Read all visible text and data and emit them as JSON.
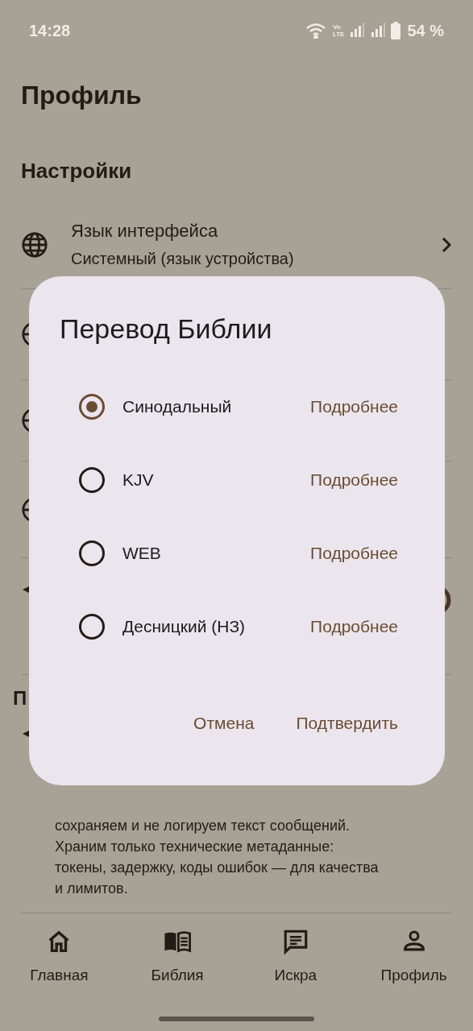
{
  "status_bar": {
    "time": "14:28",
    "network_badge": [
      "Vo",
      "LTE"
    ],
    "battery": "54 %"
  },
  "page": {
    "title": "Профиль",
    "section": "Настройки",
    "rows": [
      {
        "kind": "language",
        "title": "Язык интерфейса",
        "subtitle": "Системный (язык устройства)"
      },
      {
        "kind": "setting"
      },
      {
        "kind": "setting"
      },
      {
        "kind": "setting"
      },
      {
        "kind": "toggle"
      }
    ],
    "section2": "П",
    "info_text": "сохраняем и не логируем текст сообщений.\nХраним только технические метаданные:\nтокены, задержку, коды ошибок — для качества\nи лимитов."
  },
  "dialog": {
    "title": "Перевод Библии",
    "options": [
      {
        "label": "Синодальный",
        "selected": true,
        "link": "Подробнее"
      },
      {
        "label": "KJV",
        "selected": false,
        "link": "Подробнее"
      },
      {
        "label": "WEB",
        "selected": false,
        "link": "Подробнее"
      },
      {
        "label": "Десницкий (НЗ)",
        "selected": false,
        "link": "Подробнее"
      }
    ],
    "buttons": [
      "Отмена",
      "Подтвердить"
    ]
  },
  "bottom_nav": [
    {
      "kind": "home",
      "label": "Главная"
    },
    {
      "kind": "bible",
      "label": "Библия"
    },
    {
      "kind": "chat",
      "label": "Искра"
    },
    {
      "kind": "profile",
      "label": "Профиль"
    }
  ]
}
